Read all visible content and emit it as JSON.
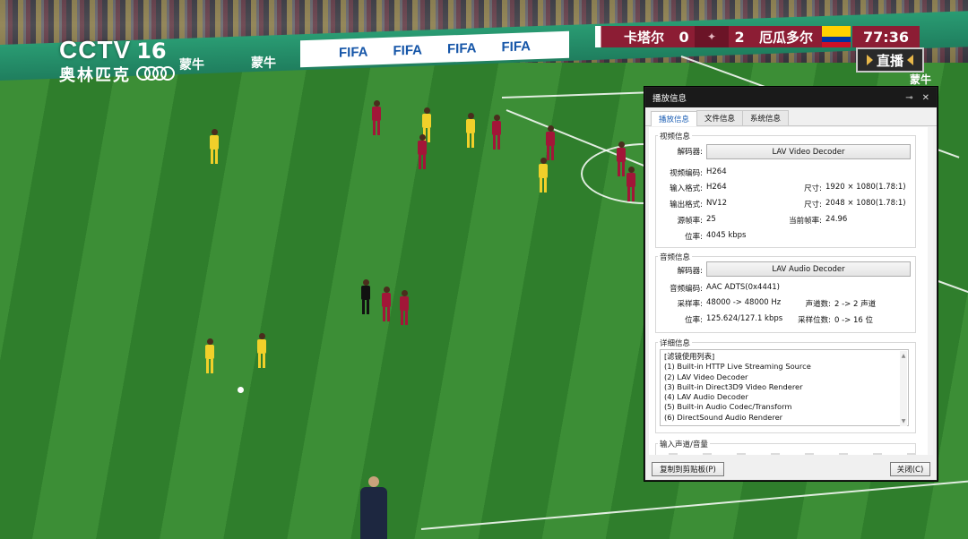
{
  "broadcast": {
    "brand": "CCTV",
    "channel": "16",
    "subtitle": "奥林匹克",
    "sponsor": "蒙牛",
    "board_text": "FIFA",
    "home_team": "卡塔尔",
    "home_score": "0",
    "away_score": "2",
    "away_team": "厄瓜多尔",
    "match_time": "77:36",
    "live_label": "直播"
  },
  "dialog": {
    "title": "播放信息",
    "pin_icon": "pin-icon",
    "close_icon": "close-icon",
    "tabs": [
      "播放信息",
      "文件信息",
      "系统信息"
    ],
    "video": {
      "section": "视频信息",
      "decoder_label": "解码器:",
      "decoder_value": "LAV Video Decoder",
      "codec_label": "视频编码:",
      "codec_value": "H264",
      "input_label": "输入格式:",
      "input_value": "H264",
      "input_size_label": "尺寸:",
      "input_size_value": "1920 × 1080(1.78:1)",
      "output_label": "输出格式:",
      "output_value": "NV12",
      "output_size_label": "尺寸:",
      "output_size_value": "2048 × 1080(1.78:1)",
      "src_fps_label": "源帧率:",
      "src_fps_value": "25",
      "cur_fps_label": "当前帧率:",
      "cur_fps_value": "24.96",
      "bitrate_label": "位率:",
      "bitrate_value": "4045 kbps"
    },
    "audio": {
      "section": "音频信息",
      "decoder_label": "解码器:",
      "decoder_value": "LAV Audio Decoder",
      "codec_label": "音频编码:",
      "codec_value": "AAC ADTS(0x4441)",
      "rate_label": "采样率:",
      "rate_value": "48000 -> 48000 Hz",
      "channels_label": "声道数:",
      "channels_value": "2 -> 2 声道",
      "bitrate_label": "位率:",
      "bitrate_value": "125.624/127.1 kbps",
      "bits_label": "采样位数:",
      "bits_value": "0 -> 16 位"
    },
    "details": {
      "section": "详细信息",
      "lines": [
        "[滤镜使用列表]",
        "(1) Built-in HTTP Live Streaming Source",
        "(2) LAV Video Decoder",
        "(3) Built-in Direct3D9 Video Renderer",
        "(4) LAV Audio Decoder",
        "(5) Built-in Audio Codec/Transform",
        "(6) DirectSound Audio Renderer"
      ]
    },
    "volume_section": "输入声道/音量",
    "copy_button": "复制到剪贴板(P)",
    "close_button": "关闭(C)"
  }
}
